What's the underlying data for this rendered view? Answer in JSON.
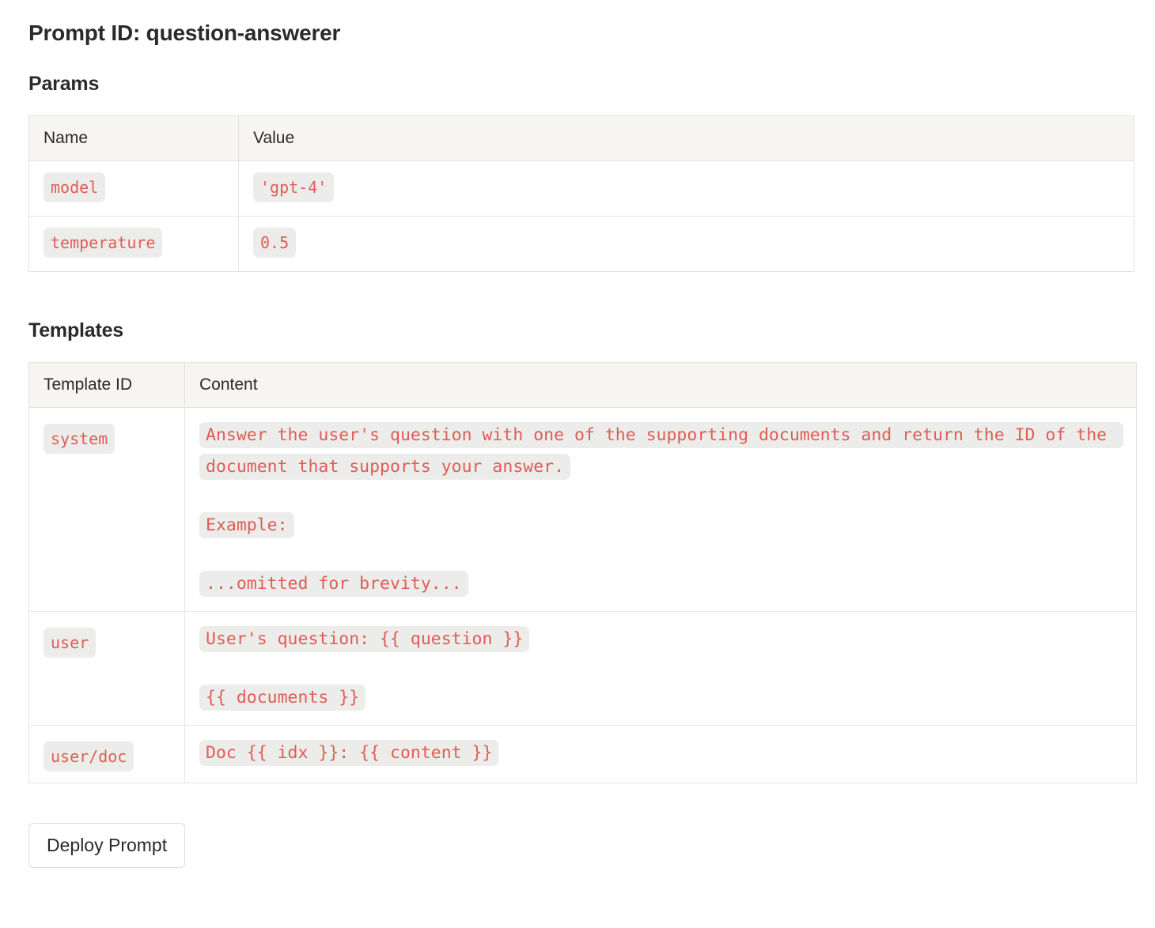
{
  "page": {
    "title": "Prompt ID: question-answerer"
  },
  "params_section": {
    "heading": "Params",
    "columns": [
      "Name",
      "Value"
    ],
    "rows": [
      {
        "name": "model",
        "value": "'gpt-4'"
      },
      {
        "name": "temperature",
        "value": "0.5"
      }
    ]
  },
  "templates_section": {
    "heading": "Templates",
    "columns": [
      "Template ID",
      "Content"
    ],
    "rows": [
      {
        "template_id": "system",
        "blocks": [
          "Answer the user's question with one of the supporting documents and return the ID of the document that supports your answer.",
          "Example:",
          "...omitted for brevity..."
        ]
      },
      {
        "template_id": "user",
        "blocks": [
          "User's question: {{ question }}",
          "{{ documents }}"
        ]
      },
      {
        "template_id": "user/doc",
        "blocks": [
          "Doc {{ idx }}: {{ content }}"
        ]
      }
    ]
  },
  "actions": {
    "deploy_label": "Deploy Prompt"
  },
  "colors": {
    "code_text": "#e05d55",
    "code_background": "#ececea",
    "table_header_background": "#f6f5f1",
    "table_border": "#e3e2de",
    "text": "#2b2a28"
  }
}
